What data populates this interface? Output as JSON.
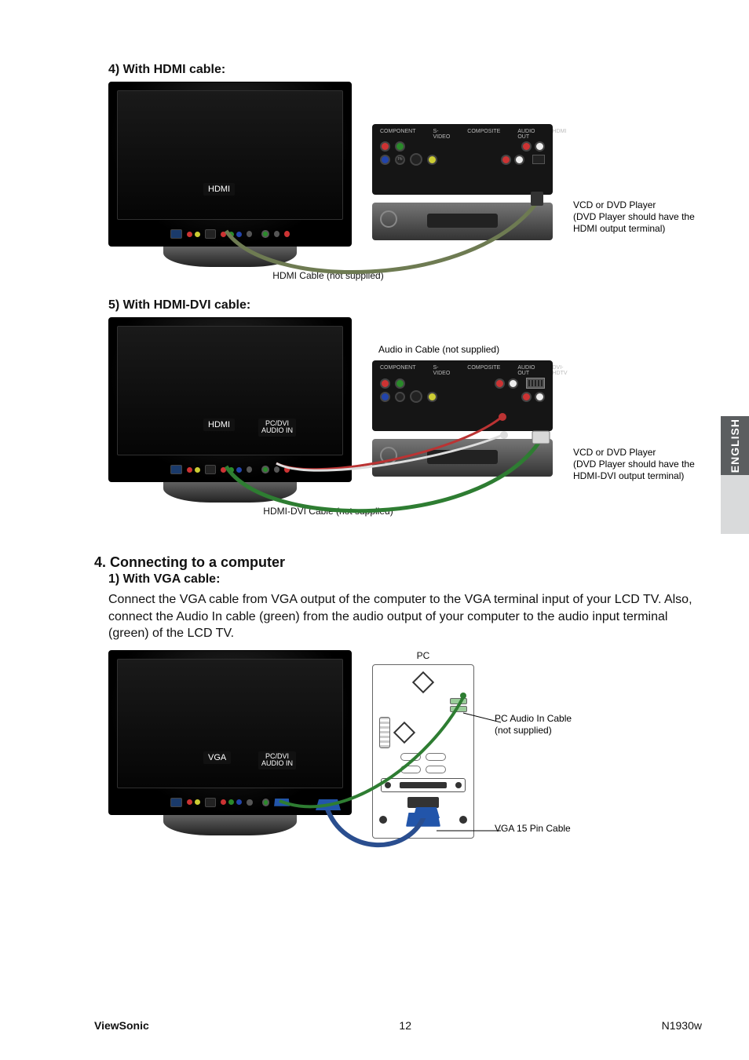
{
  "sideTab": "ENGLISH",
  "sec4": {
    "title": "4) With HDMI cable:",
    "tvPort": "HDMI",
    "rear": {
      "labels": [
        "COMPONENT",
        "S-VIDEO",
        "COMPOSITE",
        "AUDIO OUT",
        "HDMI"
      ]
    },
    "note": " VCD or DVD Player\n(DVD Player should have the HDMI output terminal)",
    "caption": "HDMI Cable (not supplied)"
  },
  "sec5": {
    "title": "5) With HDMI-DVI cable:",
    "tvPort": "HDMI",
    "tvAudioPort": "PC/DVI\nAUDIO IN",
    "audioCap": "Audio in Cable (not supplied)",
    "rear": {
      "labels": [
        "COMPONENT",
        "S-VIDEO",
        "COMPOSITE",
        "AUDIO OUT",
        "DVI-HDTV"
      ]
    },
    "note": " VCD or DVD Player\n(DVD Player should have the HDMI-DVI output terminal)",
    "caption": "HDMI-DVI Cable (not supplied)"
  },
  "sec6": {
    "heading": "4. Connecting to a computer",
    "sub": "1) With VGA cable:",
    "body": "Connect the VGA cable from VGA output of the computer to the VGA terminal input of your LCD TV. Also, connect the Audio In cable (green) from the audio output of your computer to the audio input terminal (green) of the LCD TV.",
    "tvPort": "VGA",
    "tvAudioPort": "PC/DVI\nAUDIO IN",
    "pcLabel": "PC",
    "note1": "PC Audio In Cable\n(not supplied)",
    "note2": "VGA 15 Pin Cable"
  },
  "footer": {
    "brand": "ViewSonic",
    "page": "12",
    "model": "N1930w"
  },
  "colors": {
    "cableGreen": "#2e7d32",
    "vgaBlue": "#2255aa"
  }
}
